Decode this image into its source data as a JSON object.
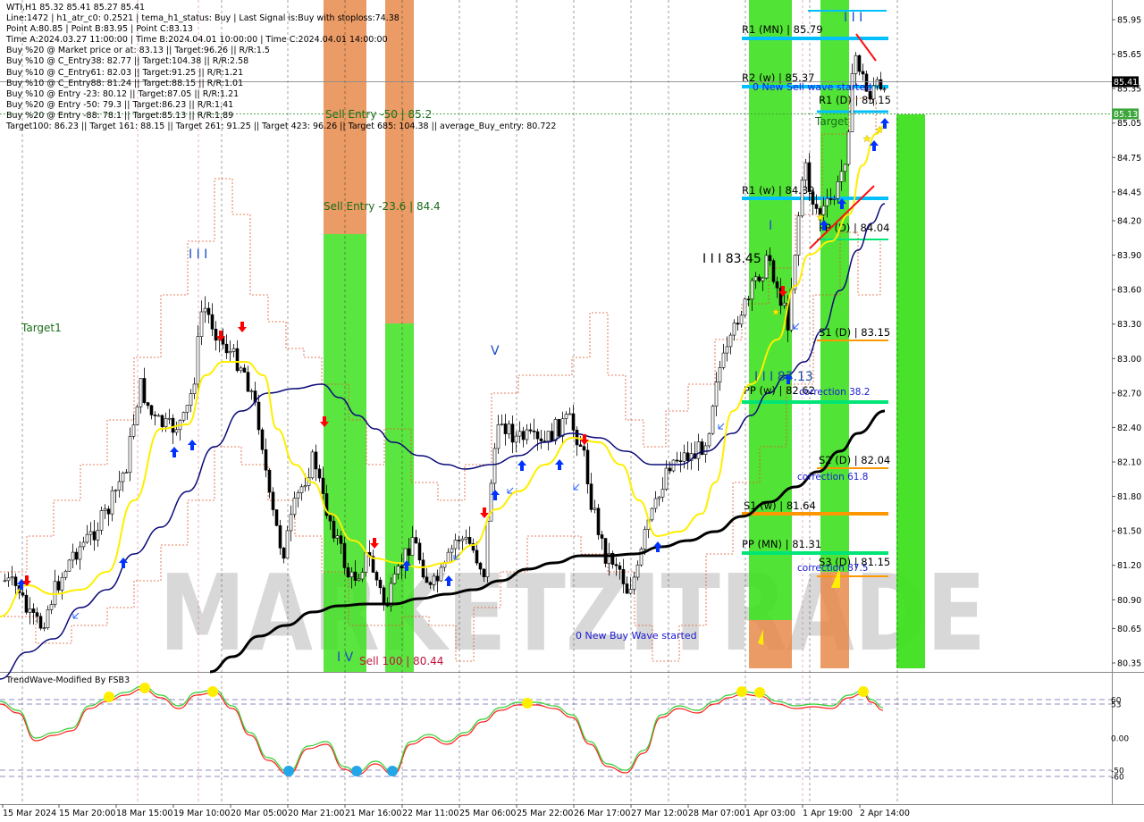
{
  "info_lines": [
    "WTI,H1  85.32 85.41 85.27 85.41",
    "Line:1472  |  h1_atr_c0: 0.2521  |  tema_h1_status: Buy  |  Last Signal is:Buy with stoploss:74.38",
    "Point A:80.85  |  Point B:83.95  |  Point C:83.13",
    "Time A:2024.03.27 11:00:00  |  Time B:2024.04.01 10:00:00  |  Time C:2024.04.01 14:00:00",
    "Buy %20 @ Market price or at: 83.13  ||  Target:96.26  ||  R/R:1.5",
    "Buy %10 @ C_Entry38: 82.77  ||  Target:104.38  ||  R/R:2.58",
    "Buy %10 @ C_Entry61: 82.03  ||  Target:91.25  ||  R/R:1.21",
    "Buy %10 @ C_Entry88: 81.24  ||  Target:88.15  ||  R/R:1.01",
    "Buy %10 @ Entry -23: 80.12  ||  Target:87.05  ||  R/R:1.21",
    "Buy %20 @ Entry -50: 79.3  ||  Target:86.23  ||  R/R:1.41",
    "Buy %20 @ Entry -88: 78.1  ||  Target:85.13  ||  R/R:1.89",
    "Target100: 86.23  ||  Target 161: 88.15  ||  Target 261: 91.25  ||  Target 423: 96.26  ||  Target 685: 104.38  ||  average_Buy_entry: 80.722"
  ],
  "price_axis": [
    "85.95",
    "85.65",
    "85.35",
    "85.05",
    "84.75",
    "84.45",
    "84.20",
    "83.90",
    "83.60",
    "83.30",
    "83.00",
    "82.70",
    "82.40",
    "82.10",
    "81.80",
    "81.50",
    "81.20",
    "80.90",
    "80.65",
    "80.35"
  ],
  "current_price": "85.41",
  "target_price": "85.13",
  "time_axis": [
    "15 Mar 2024",
    "15 Mar 20:00",
    "18 Mar 15:00",
    "19 Mar 10:00",
    "20 Mar 05:00",
    "20 Mar 21:00",
    "21 Mar 16:00",
    "22 Mar 11:00",
    "25 Mar 06:00",
    "25 Mar 22:00",
    "26 Mar 17:00",
    "27 Mar 12:00",
    "28 Mar 07:00",
    "1 Apr 03:00",
    "1 Apr 19:00",
    "2 Apr 14:00"
  ],
  "levels": [
    {
      "label": "R1 (MN) | 85.79",
      "color": "#00bfff"
    },
    {
      "label": "R2 (w) | 85.37",
      "color": "#00bfff"
    },
    {
      "label": "R1 (D) | 85.15",
      "color": "#00bfff"
    },
    {
      "label": "R1 (w) | 84.39",
      "color": "#00bfff"
    },
    {
      "label": "PP (D) | 84.04",
      "color": "#00e676"
    },
    {
      "label": "S1 (D) | 83.15",
      "color": "#ff9800"
    },
    {
      "label": "PP (w) | 82.62",
      "color": "#00e676"
    },
    {
      "label": "S2 (D) | 82.04",
      "color": "#ff9800"
    },
    {
      "label": "S1 (w) | 81.64",
      "color": "#ff9800"
    },
    {
      "label": "PP (MN) | 81.31",
      "color": "#00e676"
    },
    {
      "label": "S3 (D) | 81.15",
      "color": "#ff9800"
    }
  ],
  "annotations": {
    "sell_entry_50": "Sell Entry -50 | 85.2",
    "sell_entry_236": "Sell Entry -23.6 | 84.4",
    "sell_100": "Sell 100 | 80.44",
    "target1": "Target1",
    "target_right": "Target",
    "new_sell_wave": "0 New Sell wave started",
    "new_buy_wave": "0 New Buy Wave started",
    "wave_label_8345": "I I I  83.45",
    "wave_label_8313": "I I I  83.13",
    "correction_382": "correction 38.2",
    "correction_618": "correction 61.8",
    "correction_875": "correction 87.5",
    "wave_iii_top_left": "I I I",
    "wave_iii_top_right": "I I I",
    "wave_v": "V",
    "wave_iv": "I V",
    "wave_i": "I"
  },
  "oscillator": {
    "title": "TrendWave-Modified By FSB3",
    "axis": [
      "60",
      "53",
      "0.00",
      "-50",
      "-60"
    ]
  },
  "watermark": "MARKETZITRADE",
  "colors": {
    "bull_zone": "#3ee01f",
    "bear_zone": "#e8894a",
    "yellow_ma": "#ffee00",
    "navy_ma": "#0a0a7a",
    "black_ma": "#000000",
    "buy_arrow": "#0033ff",
    "sell_arrow": "#ff0000"
  }
}
